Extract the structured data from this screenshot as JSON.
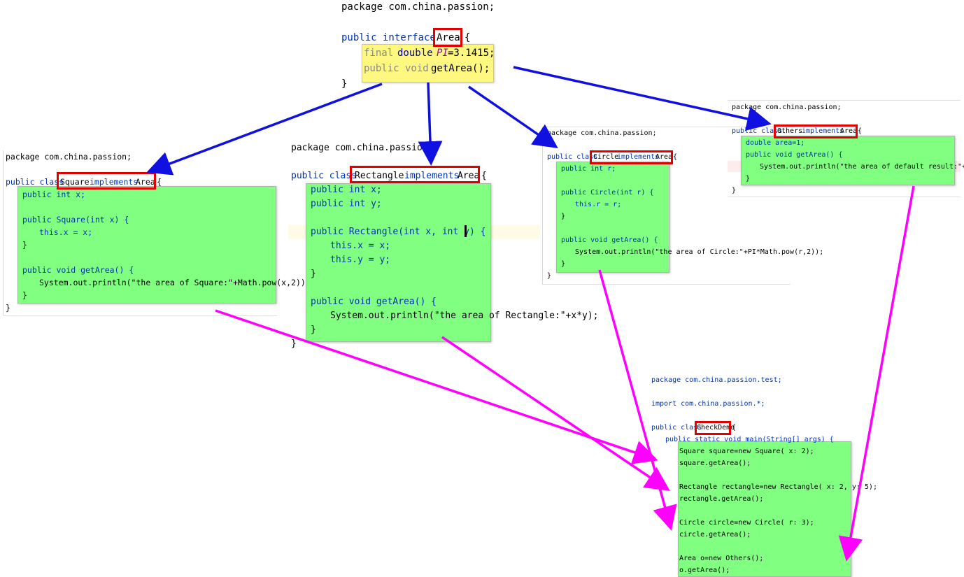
{
  "area": {
    "package": "package com.china.passion;",
    "decl_kw": "public interface",
    "name": "Area",
    "brace": "{",
    "line1_final": "final",
    "line1_type": "double",
    "line1_name": "PI",
    "line1_val": "=3.1415;",
    "line2_kw": "public void",
    "line2_rest": "getArea();",
    "close": "}"
  },
  "square": {
    "package": "package com.china.passion;",
    "decl_kw": "public class",
    "name": "Square",
    "impl": "implements",
    "iface": "Area",
    "brace": "{",
    "l1": "public int x;",
    "l2": "public Square(int x) {",
    "l3": "this.x = x;",
    "l4": "}",
    "l5": "public void getArea() {",
    "l6": "System.out.println(\"the area of Square:\"+Math.pow(x,2));",
    "l7": "}",
    "close": "}"
  },
  "rectangle": {
    "package": "package com.china.passion;",
    "decl_kw": "public class",
    "name": "Rectangle",
    "impl": "implements",
    "iface": "Area",
    "brace": "{",
    "l1": "public int x;",
    "l2": "public int y;",
    "l3": "public Rectangle(int x, int y) {",
    "l4": "this.x = x;",
    "l5": "this.y = y;",
    "l6": "}",
    "l7": "public void getArea() {",
    "l8": "System.out.println(\"the area of Rectangle:\"+x*y);",
    "l9": "}",
    "close": "}"
  },
  "circle": {
    "package": "package com.china.passion;",
    "decl_kw": "public class",
    "name": "Circle",
    "impl": "implements",
    "iface": "Area",
    "brace": "{",
    "l1": "public int r;",
    "l2": "public Circle(int r) {",
    "l3": "this.r = r;",
    "l4": "}",
    "l5": "public void getArea() {",
    "l6": "System.out.println(\"the area of Circle:\"+PI*Math.pow(r,2));",
    "l7": "}",
    "close": "}"
  },
  "others": {
    "package": "package com.china.passion;",
    "decl_kw": "public class",
    "name": "Others",
    "impl": "implements",
    "iface": "Area",
    "brace": "{",
    "l1": "double area=1;",
    "l2": "public void getArea() {",
    "l3": "System.out.println(\"the area of default result:\"+area);",
    "l4": "}",
    "close": "}"
  },
  "checkdemo": {
    "package": "package com.china.passion.test;",
    "import": "import com.china.passion.*;",
    "decl_kw": "public class",
    "name": "CheckDemo",
    "brace": "{",
    "main": "public static void main(String[] args) {",
    "l1": "Square square=new Square( x: 2);",
    "l2": "square.getArea();",
    "l3": "Rectangle rectangle=new Rectangle( x: 2, y: 5);",
    "l4": "rectangle.getArea();",
    "l5": "Circle circle=new Circle( r: 3);",
    "l6": "circle.getArea();",
    "l7": "Area o=new Others();",
    "l8": "o.getArea();"
  },
  "colors": {
    "implements_arrow": "#1010e0",
    "usage_arrow": "#ff00ff",
    "highlight": "#80ff80",
    "interface_highlight": "#fff880",
    "box": "#e00000"
  }
}
